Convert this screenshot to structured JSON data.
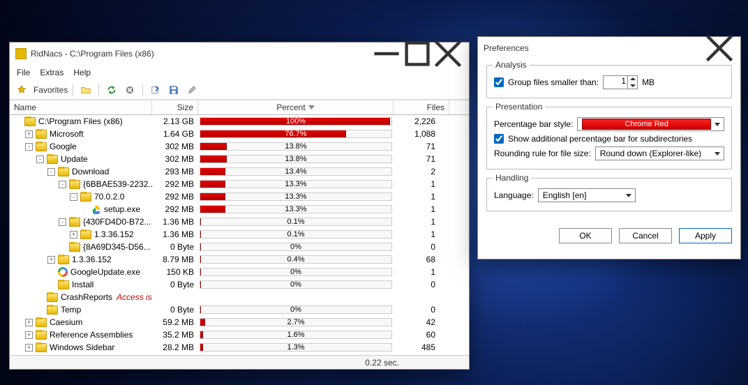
{
  "main": {
    "title": "RidNacs - C:\\Program Files (x86)",
    "menu": {
      "file": "File",
      "extras": "Extras",
      "help": "Help"
    },
    "favorites": "Favorites",
    "columns": {
      "name": "Name",
      "size": "Size",
      "percent": "Percent",
      "files": "Files"
    },
    "rows": [
      {
        "indent": 0,
        "exp": "",
        "icon": "folder",
        "name": "C:\\Program Files (x86)",
        "size": "2.13 GB",
        "pct": 100,
        "pctLabel": "100%",
        "files": "2,226",
        "white": true
      },
      {
        "indent": 1,
        "exp": "+",
        "icon": "folder",
        "name": "Microsoft",
        "size": "1.64 GB",
        "pct": 76.7,
        "pctLabel": "76.7%",
        "files": "1,088",
        "white": true
      },
      {
        "indent": 1,
        "exp": "-",
        "icon": "folder",
        "name": "Google",
        "size": "302 MB",
        "pct": 13.8,
        "pctLabel": "13.8%",
        "files": "71"
      },
      {
        "indent": 2,
        "exp": "-",
        "icon": "folder",
        "name": "Update",
        "size": "302 MB",
        "pct": 13.8,
        "pctLabel": "13.8%",
        "files": "71"
      },
      {
        "indent": 3,
        "exp": "-",
        "icon": "folder",
        "name": "Download",
        "size": "293 MB",
        "pct": 13.4,
        "pctLabel": "13.4%",
        "files": "2"
      },
      {
        "indent": 4,
        "exp": "-",
        "icon": "folder",
        "name": "{6BBAE539-2232...",
        "size": "292 MB",
        "pct": 13.3,
        "pctLabel": "13.3%",
        "files": "1"
      },
      {
        "indent": 5,
        "exp": "-",
        "icon": "folder",
        "name": "70.0.2.0",
        "size": "292 MB",
        "pct": 13.3,
        "pctLabel": "13.3%",
        "files": "1"
      },
      {
        "indent": 6,
        "exp": "",
        "icon": "gdrive",
        "name": "setup.exe",
        "size": "292 MB",
        "pct": 13.3,
        "pctLabel": "13.3%",
        "files": "1"
      },
      {
        "indent": 4,
        "exp": "-",
        "icon": "folder",
        "name": "{430FD4D0-B72...",
        "size": "1.36 MB",
        "pct": 0.1,
        "pctLabel": "0.1%",
        "files": "1"
      },
      {
        "indent": 5,
        "exp": "+",
        "icon": "folder",
        "name": "1.3.36.152",
        "size": "1.36 MB",
        "pct": 0.1,
        "pctLabel": "0.1%",
        "files": "1"
      },
      {
        "indent": 4,
        "exp": "",
        "icon": "folder",
        "name": "{8A69D345-D56...",
        "size": "0 Byte",
        "pct": 0,
        "pctLabel": "0%",
        "files": "0"
      },
      {
        "indent": 3,
        "exp": "+",
        "icon": "folder",
        "name": "1.3.36.152",
        "size": "8.79 MB",
        "pct": 0.4,
        "pctLabel": "0.4%",
        "files": "68"
      },
      {
        "indent": 3,
        "exp": "",
        "icon": "gu",
        "name": "GoogleUpdate.exe",
        "size": "150 KB",
        "pct": 0,
        "pctLabel": "0%",
        "files": "1"
      },
      {
        "indent": 3,
        "exp": "",
        "icon": "folder",
        "name": "Install",
        "size": "0 Byte",
        "pct": 0,
        "pctLabel": "0%",
        "files": "0"
      },
      {
        "indent": 2,
        "exp": "",
        "icon": "folder",
        "name": "CrashReports",
        "denied": "Access is denied",
        "size": "",
        "pct": null,
        "pctLabel": "",
        "files": ""
      },
      {
        "indent": 2,
        "exp": "",
        "icon": "folder",
        "name": "Temp",
        "size": "0 Byte",
        "pct": 0,
        "pctLabel": "0%",
        "files": "0"
      },
      {
        "indent": 1,
        "exp": "+",
        "icon": "folder",
        "name": "Caesium",
        "size": "59.2 MB",
        "pct": 2.7,
        "pctLabel": "2.7%",
        "files": "42"
      },
      {
        "indent": 1,
        "exp": "+",
        "icon": "folder",
        "name": "Reference Assemblies",
        "size": "35.2 MB",
        "pct": 1.6,
        "pctLabel": "1.6%",
        "files": "60"
      },
      {
        "indent": 1,
        "exp": "+",
        "icon": "folder",
        "name": "Windows Sidebar",
        "size": "28.2 MB",
        "pct": 1.3,
        "pctLabel": "1.3%",
        "files": "485"
      }
    ],
    "status": "0.22 sec."
  },
  "pref": {
    "title": "Preferences",
    "analysis": {
      "legend": "Analysis",
      "group_label": "Group files smaller than:",
      "group_value": "1",
      "unit": "MB"
    },
    "presentation": {
      "legend": "Presentation",
      "barstyle_label": "Percentage bar style:",
      "barstyle_value": "Chrome Red",
      "subdir_label": "Show additional percentage bar for subdirectories",
      "rounding_label": "Rounding rule for file size:",
      "rounding_value": "Round down (Explorer-like)"
    },
    "handling": {
      "legend": "Handling",
      "language_label": "Language:",
      "language_value": "English [en]"
    },
    "buttons": {
      "ok": "OK",
      "cancel": "Cancel",
      "apply": "Apply"
    }
  }
}
